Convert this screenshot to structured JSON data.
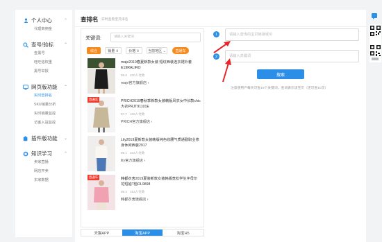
{
  "sidebar": {
    "sections": [
      {
        "title": "个人中心",
        "icon": "user-icon",
        "items": [
          "代理商佣金"
        ]
      },
      {
        "title": "查号/验标",
        "icon": "search-icon",
        "items": [
          "查黑号",
          "旺旺信权重",
          "黑号举报"
        ]
      },
      {
        "title": "网页版功能",
        "icon": "monitor-icon",
        "items": [
          "实时查排名",
          "SKU销量分析",
          "实时销量监控",
          "访客入驻监控"
        ]
      },
      {
        "title": "插件版功能",
        "icon": "puzzle-icon",
        "items": []
      },
      {
        "title": "知识学习",
        "icon": "book-icon",
        "items": [
          "卖家直播",
          "网店开卖",
          "东家数据"
        ]
      }
    ],
    "active_item": "实时查排名"
  },
  "main": {
    "title": "查排名",
    "subtitle": "实时查看宝贝排名"
  },
  "search_card": {
    "keyword_label": "关键词:",
    "keyword_placeholder": "请输入关键词",
    "filters": {
      "sort_all": "综合",
      "sales": "销量 ⇕",
      "price": "价格 ⇕",
      "region": "当前地区 ⌄",
      "direct": "直通车"
    },
    "items": [
      {
        "badge": "",
        "title": "maje2019春夏新款女装 短纹西装连衣裙外套E19RALIRO",
        "score": "99.6",
        "paid": "230人付款",
        "shop": "maje官方旗舰店"
      },
      {
        "badge": "直通车",
        "title": "PRICH2019春秋季新款女装韩版风衣女中长款chic大衣PRJT91101E",
        "score": "97.7",
        "paid": "109人付款",
        "shop": "PRICH官方旗舰店"
      },
      {
        "badge": "",
        "title": "Lily2019夏新款女装韩版纯色收腰气质通勤职业修身休闲西装2917",
        "score": "99.1",
        "paid": "234人付款",
        "shop": "lily官方旗舰店"
      },
      {
        "badge": "直通车",
        "title": "韩都衣舍2019夏装新款女装韩版宽松学生字母印花短袖T恤OL9898",
        "score": "96.3",
        "paid": "153人付款",
        "shop": "韩都衣舍旗舰店"
      }
    ],
    "tabs": [
      "天猫APP",
      "淘宝APP",
      "淘宝H5"
    ],
    "active_tab": "淘宝APP"
  },
  "form": {
    "url_placeholder": "请输入查询的宝贝链接或ID",
    "keyword_placeholder": "请输入关键词",
    "search_label": "搜索",
    "note": "注意使用户每天可查19个关键词，查词表示该宝贝（还可查10次）"
  },
  "colors": {
    "accent": "#2b8fe8",
    "orange": "#f68a1d",
    "red_badge": "#f03c2e",
    "arrow": "#e8262a"
  }
}
